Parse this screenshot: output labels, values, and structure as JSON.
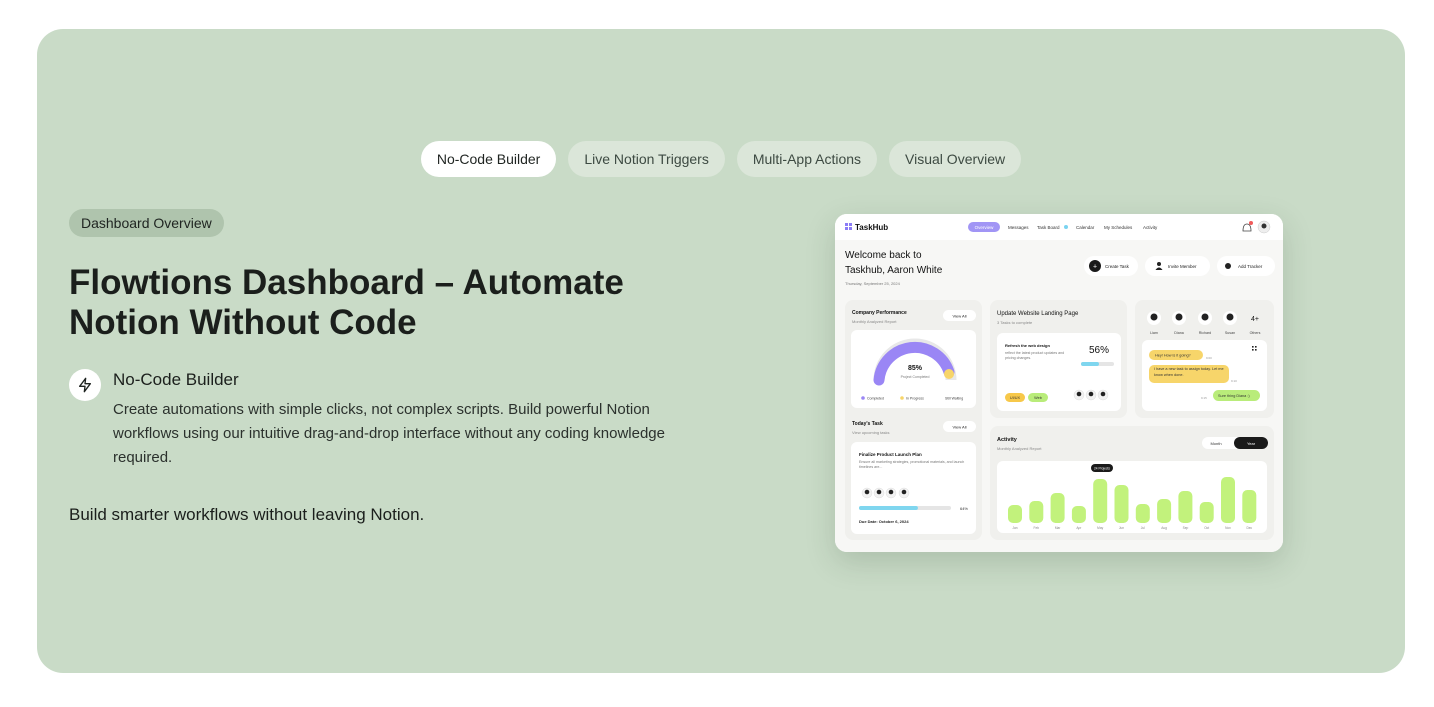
{
  "tabs": [
    {
      "label": "No-Code Builder",
      "active": true
    },
    {
      "label": "Live Notion Triggers",
      "active": false
    },
    {
      "label": "Multi-App Actions",
      "active": false
    },
    {
      "label": "Visual Overview",
      "active": false
    }
  ],
  "badge": "Dashboard Overview",
  "headline": "Flowtions Dashboard – Automate Notion Without Code",
  "feature": {
    "icon": "lightning-icon",
    "title": "No-Code Builder",
    "description": "Create automations with simple clicks, not complex scripts. Build powerful Notion workflows using our intuitive drag-and-drop interface without any coding knowledge required."
  },
  "tagline": "Build smarter workflows without leaving Notion.",
  "dashboard": {
    "brand": "TaskHub",
    "nav": [
      "Overview",
      "Messages",
      "Task Board",
      "Calendar",
      "My Schedules",
      "Activity"
    ],
    "welcome_line1": "Welcome back to",
    "welcome_line2": "Taskhub, Aaron White",
    "date": "Thursday, September 25, 2024",
    "actions": [
      "Create Task",
      "Invite Member",
      "Add Tracker"
    ],
    "performance": {
      "title": "Company Performance",
      "subtitle": "Monthly Analyzed Report",
      "view_all": "View All",
      "percent": "85%",
      "caption": "Project Completed",
      "legend": [
        "Completed",
        "In Progress",
        "Still Waiting"
      ]
    },
    "landing": {
      "title": "Update Website Landing Page",
      "subtitle": "3 Tasks to complete",
      "task": "Refresh the web design",
      "task_desc": "reflect the latest product updates and pricing changes.",
      "percent": "56%",
      "tags": [
        "UI/UX",
        "Web"
      ]
    },
    "people": {
      "names": [
        "Liam",
        "Diana",
        "Richard",
        "Susan"
      ],
      "others": "4+",
      "others_label": "Others",
      "chat": [
        "Hey! How is it going?",
        "I have a new task to assign today. Let me know when done.",
        "Sure thing Diana :)"
      ],
      "times": [
        "9:00",
        "9:10",
        "9:15"
      ]
    },
    "today": {
      "title": "Today's Task",
      "subtitle": "View upcoming tasks",
      "view_all": "View All",
      "task": "Finalize Product Launch Plan",
      "task_desc": "Ensure all marketing strategies, promotional materials, and launch timelines are...",
      "percent": "64%",
      "progress": 0.64,
      "due": "Due Date: October 6, 2024"
    },
    "activity": {
      "title": "Activity",
      "subtitle": "Monthly Analyzed Report",
      "toggle": [
        "Month",
        "Year"
      ],
      "tooltip": "24 Projects",
      "months": [
        "Jan",
        "Feb",
        "Mar",
        "Apr",
        "May",
        "Jun",
        "Jul",
        "Aug",
        "Sep",
        "Oct",
        "Nov",
        "Dec"
      ],
      "values": [
        18,
        22,
        30,
        17,
        44,
        38,
        19,
        24,
        32,
        21,
        46,
        33
      ]
    }
  }
}
